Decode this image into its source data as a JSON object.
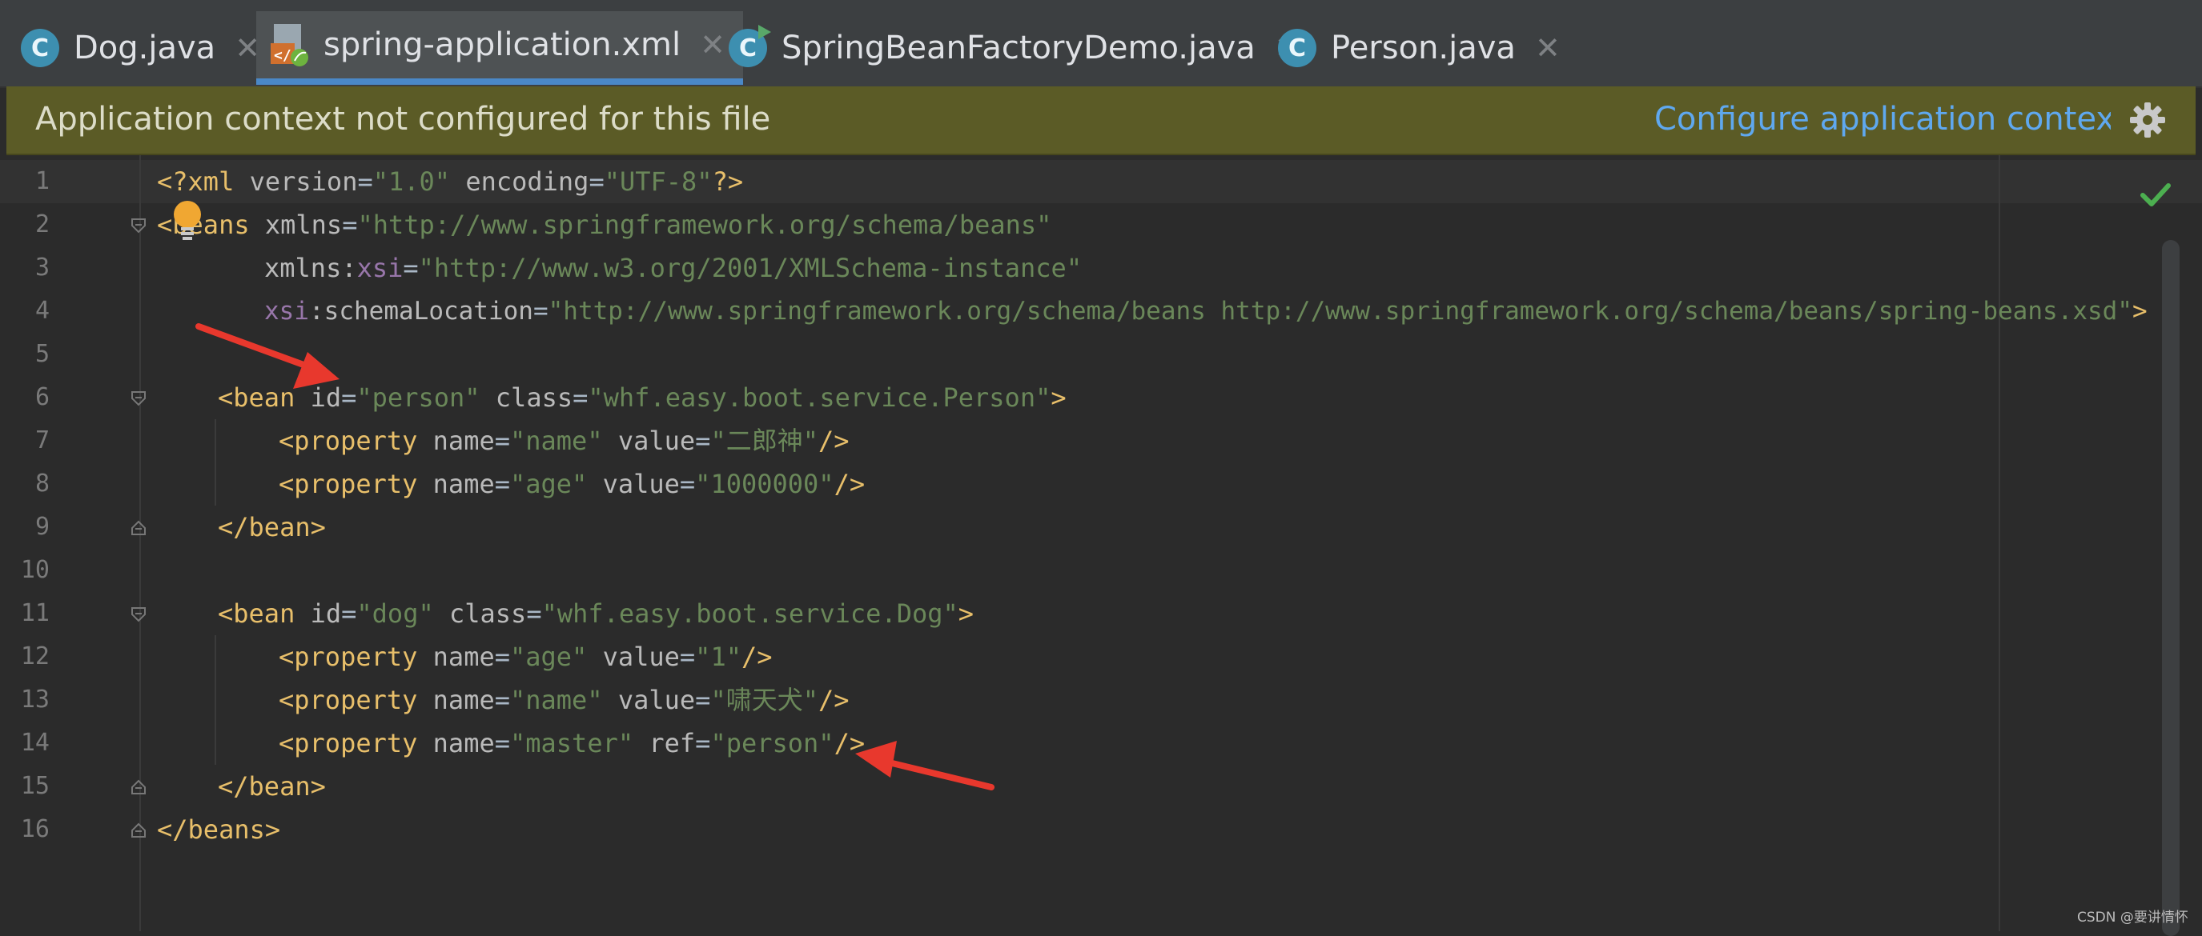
{
  "tabs": [
    {
      "label": "Dog.java",
      "icon": "class-icon",
      "letter": "C",
      "active": false
    },
    {
      "label": "spring-application.xml",
      "icon": "spring-xml-file-icon",
      "active": true
    },
    {
      "label": "SpringBeanFactoryDemo.java",
      "icon": "runnable-class-icon",
      "letter": "C",
      "active": false
    },
    {
      "label": "Person.java",
      "icon": "class-icon",
      "letter": "C",
      "active": false
    }
  ],
  "close_glyph": "✕",
  "banner": {
    "message": "Application context not configured for this file",
    "link": "Configure application context"
  },
  "line_numbers": [
    "1",
    "2",
    "3",
    "4",
    "5",
    "6",
    "7",
    "8",
    "9",
    "10",
    "11",
    "12",
    "13",
    "14",
    "15",
    "16"
  ],
  "code": {
    "l1": {
      "open": "<?xml ",
      "a1": "version",
      "eq1": "=",
      "v1": "\"1.0\"",
      "sp": " ",
      "a2": "encoding",
      "eq2": "=",
      "v2": "\"UTF-8\"",
      "close": "?>"
    },
    "l2": {
      "lt": "<",
      "tag": "beans",
      "sp": " ",
      "a1": "xmlns",
      "eq": "=",
      "v1": "\"http://www.springframework.org/schema/beans\""
    },
    "l3": {
      "a1": "xmlns",
      "colon": ":",
      "ns": "xsi",
      "eq": "=",
      "v1": "\"http://www.w3.org/2001/XMLSchema-instance\""
    },
    "l4": {
      "ns": "xsi",
      "colon": ":",
      "a1": "schemaLocation",
      "eq": "=",
      "v1": "\"http://www.springframework.org/schema/beans http://www.springframework.org/schema/beans/spring-beans.xsd\"",
      "gt": ">"
    },
    "l6": {
      "lt": "<",
      "tag": "bean",
      "sp1": " ",
      "a1": "id",
      "eq1": "=",
      "v1": "\"person\"",
      "sp2": " ",
      "a2": "class",
      "eq2": "=",
      "v2": "\"whf.easy.boot.service.Person\"",
      "gt": ">"
    },
    "l7": {
      "lt": "<",
      "tag": "property",
      "sp1": " ",
      "a1": "name",
      "eq1": "=",
      "v1": "\"name\"",
      "sp2": " ",
      "a2": "value",
      "eq2": "=",
      "v2": "\"二郎神\"",
      "end": "/>"
    },
    "l8": {
      "lt": "<",
      "tag": "property",
      "sp1": " ",
      "a1": "name",
      "eq1": "=",
      "v1": "\"age\"",
      "sp2": " ",
      "a2": "value",
      "eq2": "=",
      "v2": "\"1000000\"",
      "end": "/>"
    },
    "l9": {
      "text": "</bean>"
    },
    "l11": {
      "lt": "<",
      "tag": "bean",
      "sp1": " ",
      "a1": "id",
      "eq1": "=",
      "v1": "\"dog\"",
      "sp2": " ",
      "a2": "class",
      "eq2": "=",
      "v2": "\"whf.easy.boot.service.Dog\"",
      "gt": ">"
    },
    "l12": {
      "lt": "<",
      "tag": "property",
      "sp1": " ",
      "a1": "name",
      "eq1": "=",
      "v1": "\"age\"",
      "sp2": " ",
      "a2": "value",
      "eq2": "=",
      "v2": "\"1\"",
      "end": "/>"
    },
    "l13": {
      "lt": "<",
      "tag": "property",
      "sp1": " ",
      "a1": "name",
      "eq1": "=",
      "v1": "\"name\"",
      "sp2": " ",
      "a2": "value",
      "eq2": "=",
      "v2": "\"啸天犬\"",
      "end": "/>"
    },
    "l14": {
      "lt": "<",
      "tag": "property",
      "sp1": " ",
      "a1": "name",
      "eq1": "=",
      "v1": "\"master\"",
      "sp2": " ",
      "a2": "ref",
      "eq2": "=",
      "v2": "\"person\"",
      "end": "/>"
    },
    "l15": {
      "text": "</bean>"
    },
    "l16": {
      "text": "</beans>"
    }
  },
  "watermark": "CSDN @要讲情怀",
  "colors": {
    "tag": "#e8bf6a",
    "attr": "#bababa",
    "namespace": "#9876aa",
    "value": "#6a8759",
    "link": "#5fa8ef",
    "banner": "#5b5b26",
    "active_tab_underline": "#4a88c7",
    "annotation_arrow": "#e8382d"
  }
}
